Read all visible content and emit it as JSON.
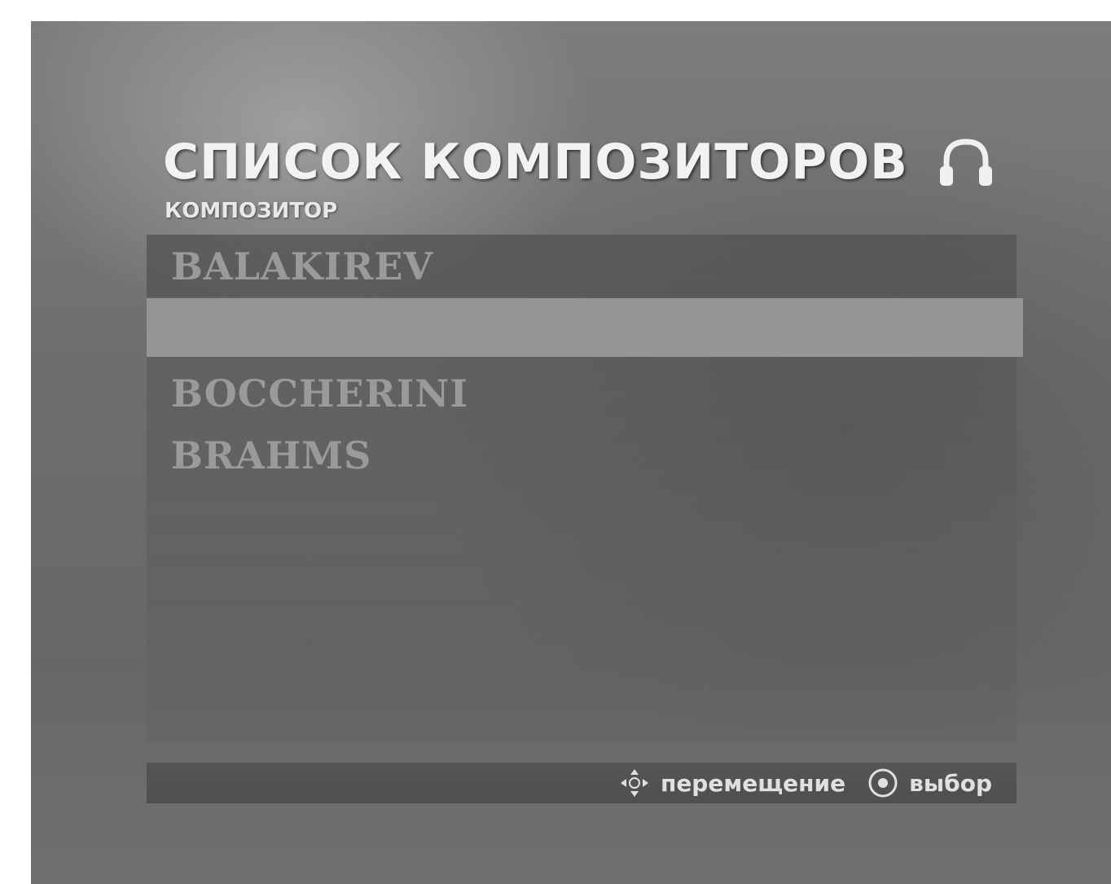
{
  "header": {
    "title": "СПИСОК КОМПОЗИТОРОВ",
    "subtitle": "КОМПОЗИТОР",
    "mode_icon": "headphone-icon"
  },
  "composer_list": {
    "items": [
      {
        "label": "BALAKIREV"
      },
      {
        "label": ""
      },
      {
        "label": "BOCCHERINI"
      },
      {
        "label": "BRAHMS"
      }
    ],
    "selected_index": 1
  },
  "footer": {
    "move_icon": "navigation-arrows-icon",
    "move_label": "перемещение",
    "select_icon": "enter-button-icon",
    "select_label": "выбор"
  },
  "colors": {
    "title_text": "#f2f2f2",
    "list_text": "#9a9a9a",
    "selection_bar": "#959595",
    "footer_bar": "#525252"
  }
}
